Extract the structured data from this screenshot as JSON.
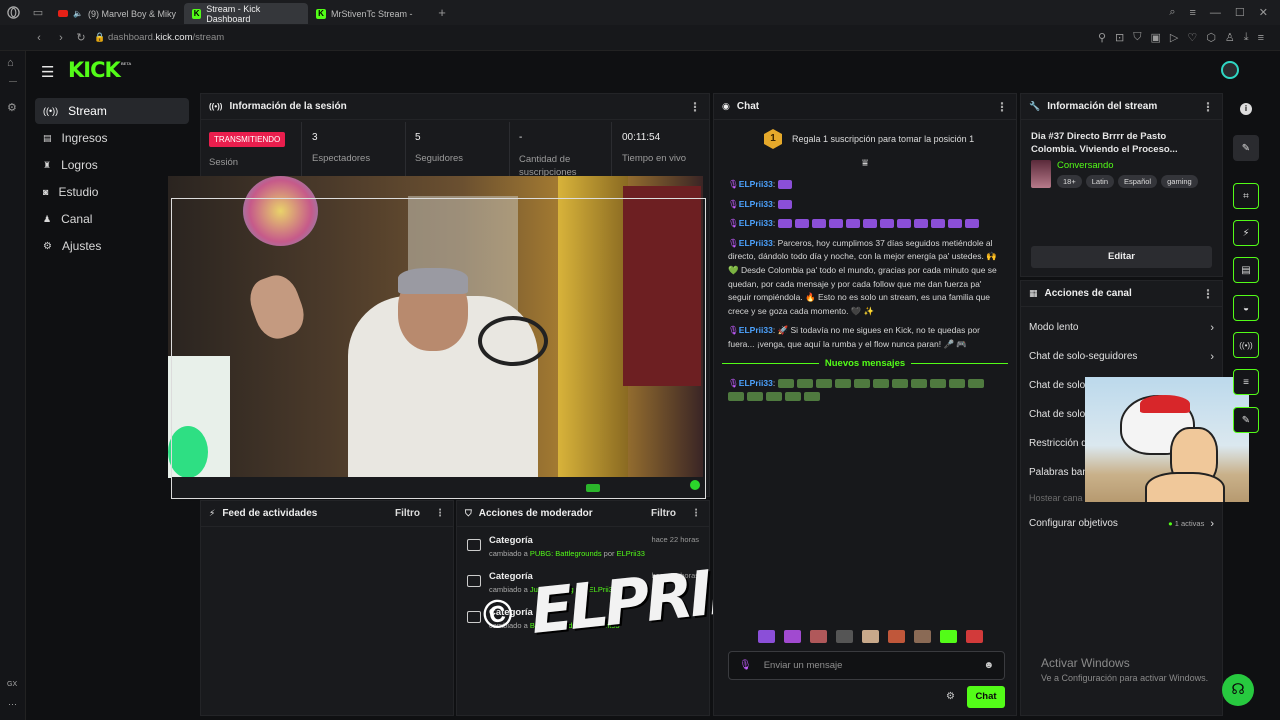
{
  "browser": {
    "tabs": [
      {
        "label": "(9) Marvel Boy & Miky"
      },
      {
        "label": "Stream - Kick Dashboard"
      },
      {
        "label": "MrStivenTc Stream - "
      }
    ],
    "new_tab": "+",
    "url_host": "dashboard.",
    "url_domain": "kick.com",
    "url_path": "/stream"
  },
  "header": {
    "logo": "KICK",
    "beta": "BETA"
  },
  "sidebar": {
    "items": [
      {
        "label": "Stream"
      },
      {
        "label": "Ingresos"
      },
      {
        "label": "Logros"
      },
      {
        "label": "Estudio"
      },
      {
        "label": "Canal"
      },
      {
        "label": "Ajustes"
      }
    ],
    "gx_label": "GX"
  },
  "session": {
    "title": "Información de la sesión",
    "status_badge": "TRANSMITIENDO",
    "status_label": "Sesión",
    "stats": [
      {
        "value": "3",
        "label": "Espectadores"
      },
      {
        "value": "5",
        "label": "Seguidores"
      },
      {
        "value": "-",
        "label": "Cantidad de suscripciones"
      },
      {
        "value": "00:11:54",
        "label": "Tiempo en vivo"
      }
    ]
  },
  "feed": {
    "title": "Feed de actividades",
    "filter": "Filtro"
  },
  "moderator": {
    "title": "Acciones de moderador",
    "filter": "Filtro",
    "items": [
      {
        "title": "Categoría",
        "time": "hace 22 horas",
        "prefix": "cambiado a ",
        "value": "PUBG: Battlegrounds",
        "by": " por ",
        "user": "ELPrii33"
      },
      {
        "title": "Categoría",
        "time": "hace 23 horas",
        "prefix": "cambiado a ",
        "value": "Just Chatting",
        "by": " por ",
        "user": "ELPrii33"
      },
      {
        "title": "Categoría",
        "time": "",
        "prefix": "cambiado a ",
        "value": "Battlegrounds",
        "by": " por ",
        "user": "ELPrii33"
      }
    ]
  },
  "chat": {
    "title": "Chat",
    "sub_prompt": "Regala 1 suscripción para tomar la posición 1",
    "sub_rank": "1",
    "messages": [
      {
        "user": "ELPrii33",
        "text": ""
      },
      {
        "user": "ELPrii33",
        "text": ""
      },
      {
        "user": "ELPrii33",
        "text": ""
      },
      {
        "user": "ELPrii33",
        "text": "Parceros, hoy cumplimos 37 días seguidos metiéndole al directo, dándolo todo día y noche, con la mejor energía pa' ustedes. 🙌 💚 Desde Colombia pa' todo el mundo, gracias por cada minuto que se quedan, por cada mensaje y por cada follow que me dan fuerza pa' seguir rompiéndola. 🔥 Esto no es solo un stream, es una familia que crece y se goza cada momento. 🖤 ✨"
      },
      {
        "user": "ELPrii33",
        "text": "🚀 Si todavía no me sigues en Kick, no te quedas por fuera... ¡venga, que aquí la rumba y el flow nunca paran! 🎤 🎮"
      }
    ],
    "new_messages": "Nuevos mensajes",
    "last_message": {
      "user": "ELPrii33",
      "text": ""
    },
    "input_placeholder": "Enviar un mensaje",
    "send_label": "Chat"
  },
  "stream_info": {
    "title": "Información del stream",
    "stream_title": "Dia #37 Directo Brrrr de Pasto Colombia. Viviendo el Proceso...",
    "category": "Conversando",
    "tags": [
      "18+",
      "Latin",
      "Español",
      "gaming"
    ],
    "edit_label": "Editar"
  },
  "channel_actions": {
    "title": "Acciones de canal",
    "items": [
      {
        "label": "Modo lento"
      },
      {
        "label": "Chat de solo-seguidores"
      },
      {
        "label": "Chat de solo"
      },
      {
        "label": "Chat de solo"
      },
      {
        "label": "Restricción d"
      },
      {
        "label": "Palabras ban"
      },
      {
        "label": "Hostear cana"
      }
    ],
    "goals_label": "Configurar objetivos",
    "goals_badge": "1 activas"
  },
  "watermark": {
    "text": "ELPRIII",
    "symbol": "©"
  },
  "windows": {
    "title": "Activar Windows",
    "subtitle": "Ve a Configuración para activar Windows."
  },
  "colors": {
    "accent": "#53fc18",
    "live": "#e91e4d",
    "user": "#4da3ff"
  }
}
